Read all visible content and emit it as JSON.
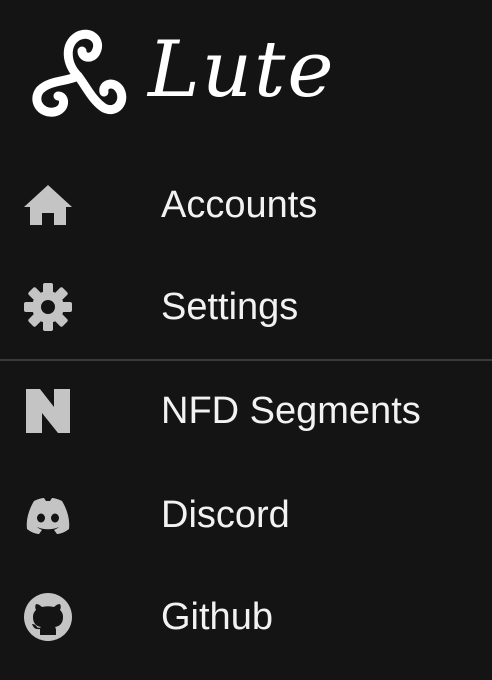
{
  "brand": {
    "name": "Lute",
    "logo_icon": "triskele-icon"
  },
  "colors": {
    "background": "#141414",
    "text": "#f2f2f2",
    "icon": "#c4c4c4",
    "divider": "#3a3a3a"
  },
  "menu": {
    "items": [
      {
        "label": "Accounts",
        "icon": "home-icon"
      },
      {
        "label": "Settings",
        "icon": "gear-icon"
      },
      {
        "label": "NFD Segments",
        "icon": "nfd-segments-icon"
      },
      {
        "label": "Discord",
        "icon": "discord-icon"
      },
      {
        "label": "Github",
        "icon": "github-icon"
      }
    ]
  }
}
